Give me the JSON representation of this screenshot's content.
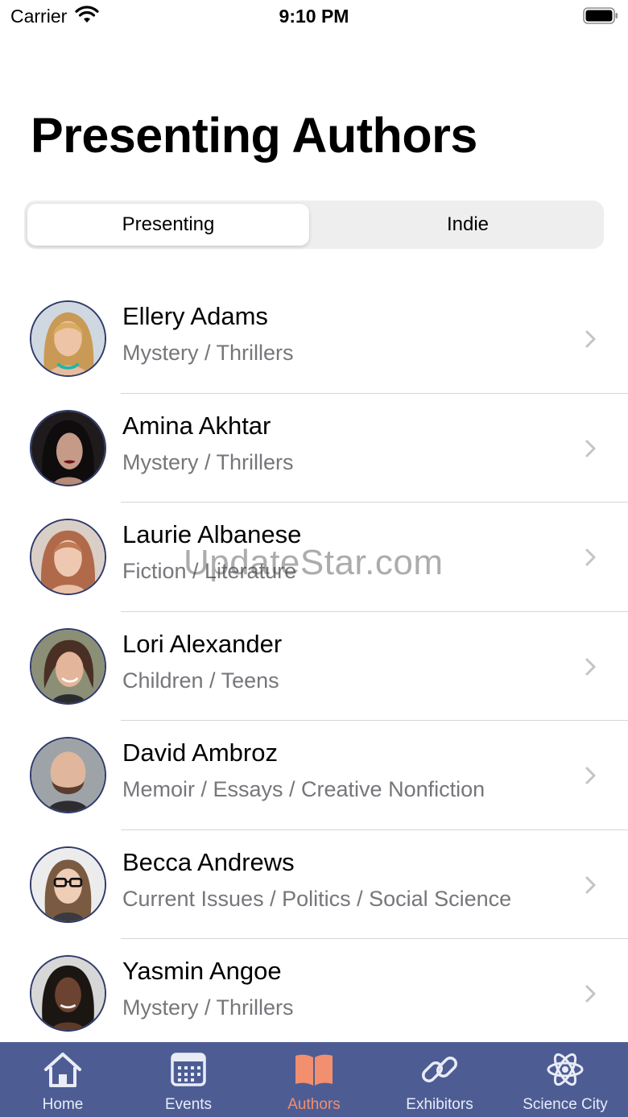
{
  "status_bar": {
    "carrier": "Carrier",
    "time": "9:10 PM",
    "icons": [
      "wifi-icon",
      "battery-icon"
    ]
  },
  "page_title": "Presenting Authors",
  "segments": {
    "selected": "Presenting",
    "other": "Indie"
  },
  "authors": [
    {
      "name": "Ellery Adams",
      "genre": "Mystery / Thrillers"
    },
    {
      "name": "Amina Akhtar",
      "genre": "Mystery / Thrillers"
    },
    {
      "name": "Laurie Albanese",
      "genre": "Fiction / Literature"
    },
    {
      "name": "Lori Alexander",
      "genre": "Children / Teens"
    },
    {
      "name": "David Ambroz",
      "genre": "Memoir / Essays / Creative Nonfiction"
    },
    {
      "name": "Becca Andrews",
      "genre": "Current Issues / Politics / Social Science"
    },
    {
      "name": "Yasmin Angoe",
      "genre": "Mystery / Thrillers"
    }
  ],
  "watermark": "UpdateStar.com",
  "tab_bar": {
    "active": "Authors",
    "active_color": "#f28f6e",
    "bar_color": "#4d5d94",
    "tabs": [
      {
        "label": "Home",
        "icon": "home-icon"
      },
      {
        "label": "Events",
        "icon": "calendar-icon"
      },
      {
        "label": "Authors",
        "icon": "book-icon"
      },
      {
        "label": "Exhibitors",
        "icon": "link-icon"
      },
      {
        "label": "Science City",
        "icon": "atom-icon"
      }
    ]
  }
}
